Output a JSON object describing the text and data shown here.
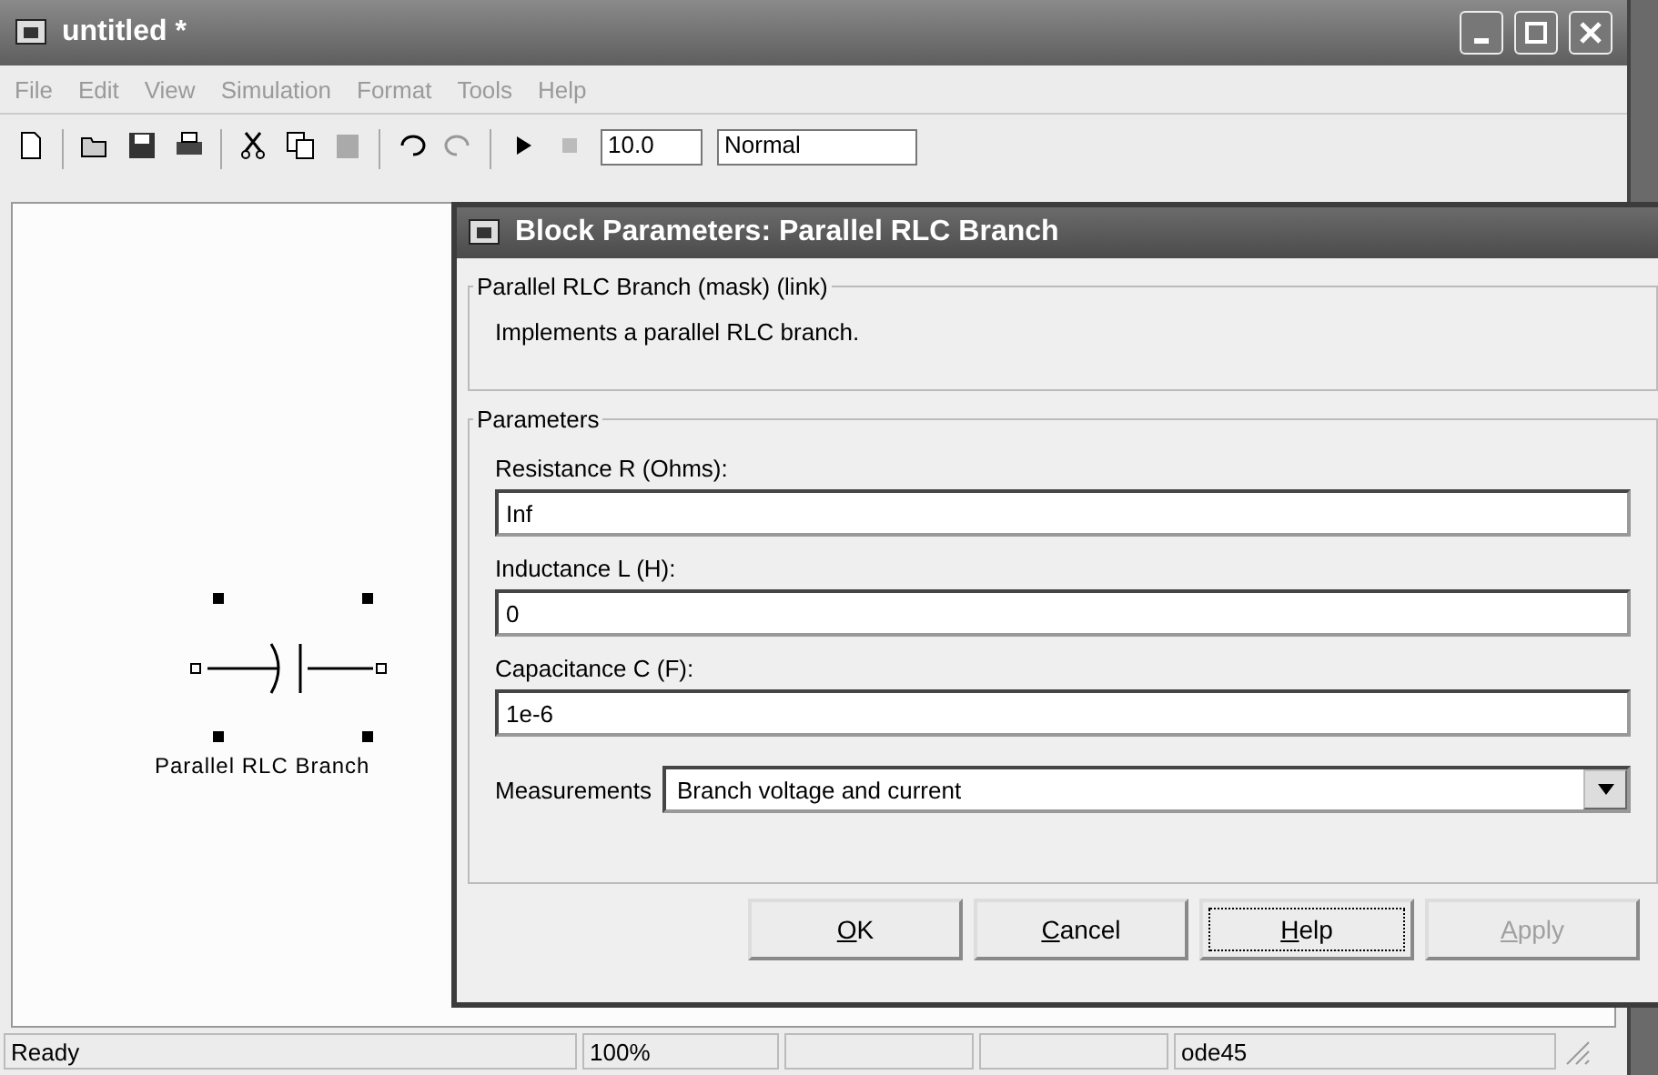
{
  "window": {
    "title": "untitled *"
  },
  "menu": [
    "File",
    "Edit",
    "View",
    "Simulation",
    "Format",
    "Tools",
    "Help"
  ],
  "toolbar": {
    "stop_time": "10.0",
    "mode": "Normal"
  },
  "canvas": {
    "block_label": "Parallel RLC Branch"
  },
  "dialog": {
    "title": "Block Parameters: Parallel RLC Branch",
    "description_group": {
      "title": "Parallel RLC Branch (mask) (link)",
      "text": "Implements a parallel RLC branch."
    },
    "parameters_group": {
      "title": "Parameters",
      "fields": [
        {
          "label": "Resistance R (Ohms):",
          "value": "Inf"
        },
        {
          "label": "Inductance L (H):",
          "value": "0"
        },
        {
          "label": "Capacitance C (F):",
          "value": "1e-6"
        }
      ],
      "measurements": {
        "label": "Measurements",
        "value": "Branch voltage and current"
      }
    },
    "buttons": [
      {
        "label": "OK",
        "disabled": false,
        "focused": false
      },
      {
        "label": "Cancel",
        "disabled": false,
        "focused": false
      },
      {
        "label": "Help",
        "disabled": false,
        "focused": true
      },
      {
        "label": "Apply",
        "disabled": true,
        "focused": false
      }
    ]
  },
  "status_bar": {
    "message": "Ready",
    "zoom": "100%",
    "solver": "ode45"
  }
}
